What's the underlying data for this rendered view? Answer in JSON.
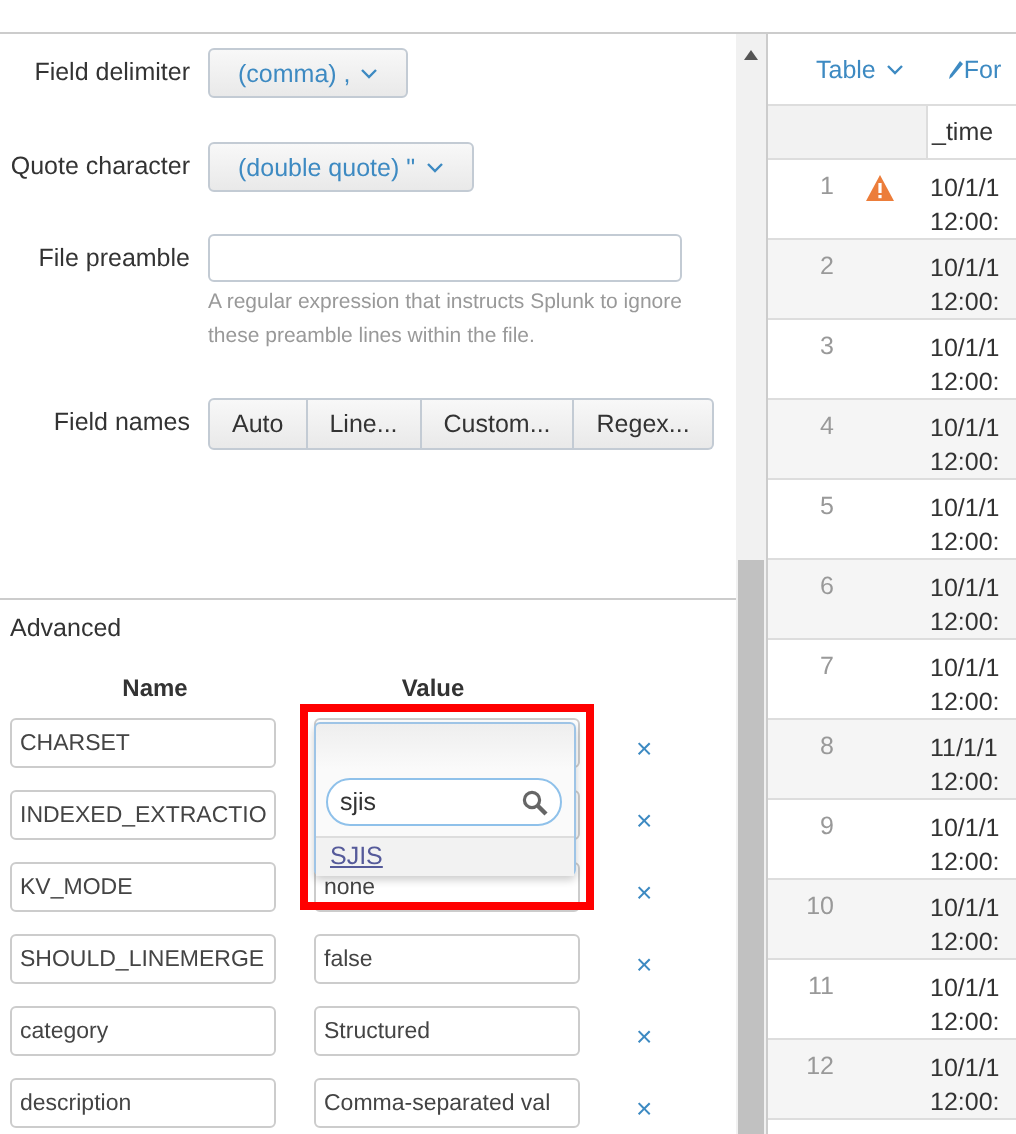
{
  "fields": [
    {
      "label": "Field delimiter",
      "kind": "dropdown",
      "value": "(comma) ,"
    },
    {
      "label": "Quote character",
      "kind": "dropdown",
      "value": "(double quote) \""
    },
    {
      "label": "File preamble",
      "kind": "text",
      "help": "A regular expression that instructs Splunk to ignore these preamble lines within the file."
    },
    {
      "label": "Field names",
      "kind": "segmented",
      "options": [
        "Auto",
        "Line...",
        "Custom...",
        "Regex..."
      ]
    }
  ],
  "advanced": {
    "title": "Advanced",
    "columns": [
      "Name",
      "Value"
    ],
    "rows": [
      {
        "name": "CHARSET",
        "remove": "×"
      },
      {
        "name": "INDEXED_EXTRACTIO",
        "remove": "×"
      },
      {
        "name": "KV_MODE",
        "value": "none",
        "remove": "×"
      },
      {
        "name": "SHOULD_LINEMERGE",
        "value": "false",
        "remove": "×"
      },
      {
        "name": "category",
        "value": "Structured",
        "remove": "×"
      },
      {
        "name": "description",
        "value": "Comma-separated val",
        "remove": "×"
      }
    ],
    "popup": {
      "search": "sjis",
      "options": [
        "SJIS"
      ]
    }
  },
  "toolbar": [
    {
      "kind": "menu",
      "label": "Table"
    },
    {
      "kind": "edit",
      "label": "For"
    }
  ],
  "table": {
    "columns": [
      "_time"
    ],
    "rows": [
      {
        "number": "1",
        "warning": true,
        "time": [
          "10/1/1",
          "12:00:"
        ]
      },
      {
        "number": "2",
        "warning": false,
        "time": [
          "10/1/1",
          "12:00:"
        ]
      },
      {
        "number": "3",
        "warning": false,
        "time": [
          "10/1/1",
          "12:00:"
        ]
      },
      {
        "number": "4",
        "warning": false,
        "time": [
          "10/1/1",
          "12:00:"
        ]
      },
      {
        "number": "5",
        "warning": false,
        "time": [
          "10/1/1",
          "12:00:"
        ]
      },
      {
        "number": "6",
        "warning": false,
        "time": [
          "10/1/1",
          "12:00:"
        ]
      },
      {
        "number": "7",
        "warning": false,
        "time": [
          "10/1/1",
          "12:00:"
        ]
      },
      {
        "number": "8",
        "warning": false,
        "time": [
          "11/1/1",
          "12:00:"
        ]
      },
      {
        "number": "9",
        "warning": false,
        "time": [
          "10/1/1",
          "12:00:"
        ]
      },
      {
        "number": "10",
        "warning": false,
        "time": [
          "10/1/1",
          "12:00:"
        ]
      },
      {
        "number": "11",
        "warning": false,
        "time": [
          "10/1/1",
          "12:00:"
        ]
      },
      {
        "number": "12",
        "warning": false,
        "time": [
          "10/1/1",
          "12:00:"
        ]
      }
    ]
  }
}
